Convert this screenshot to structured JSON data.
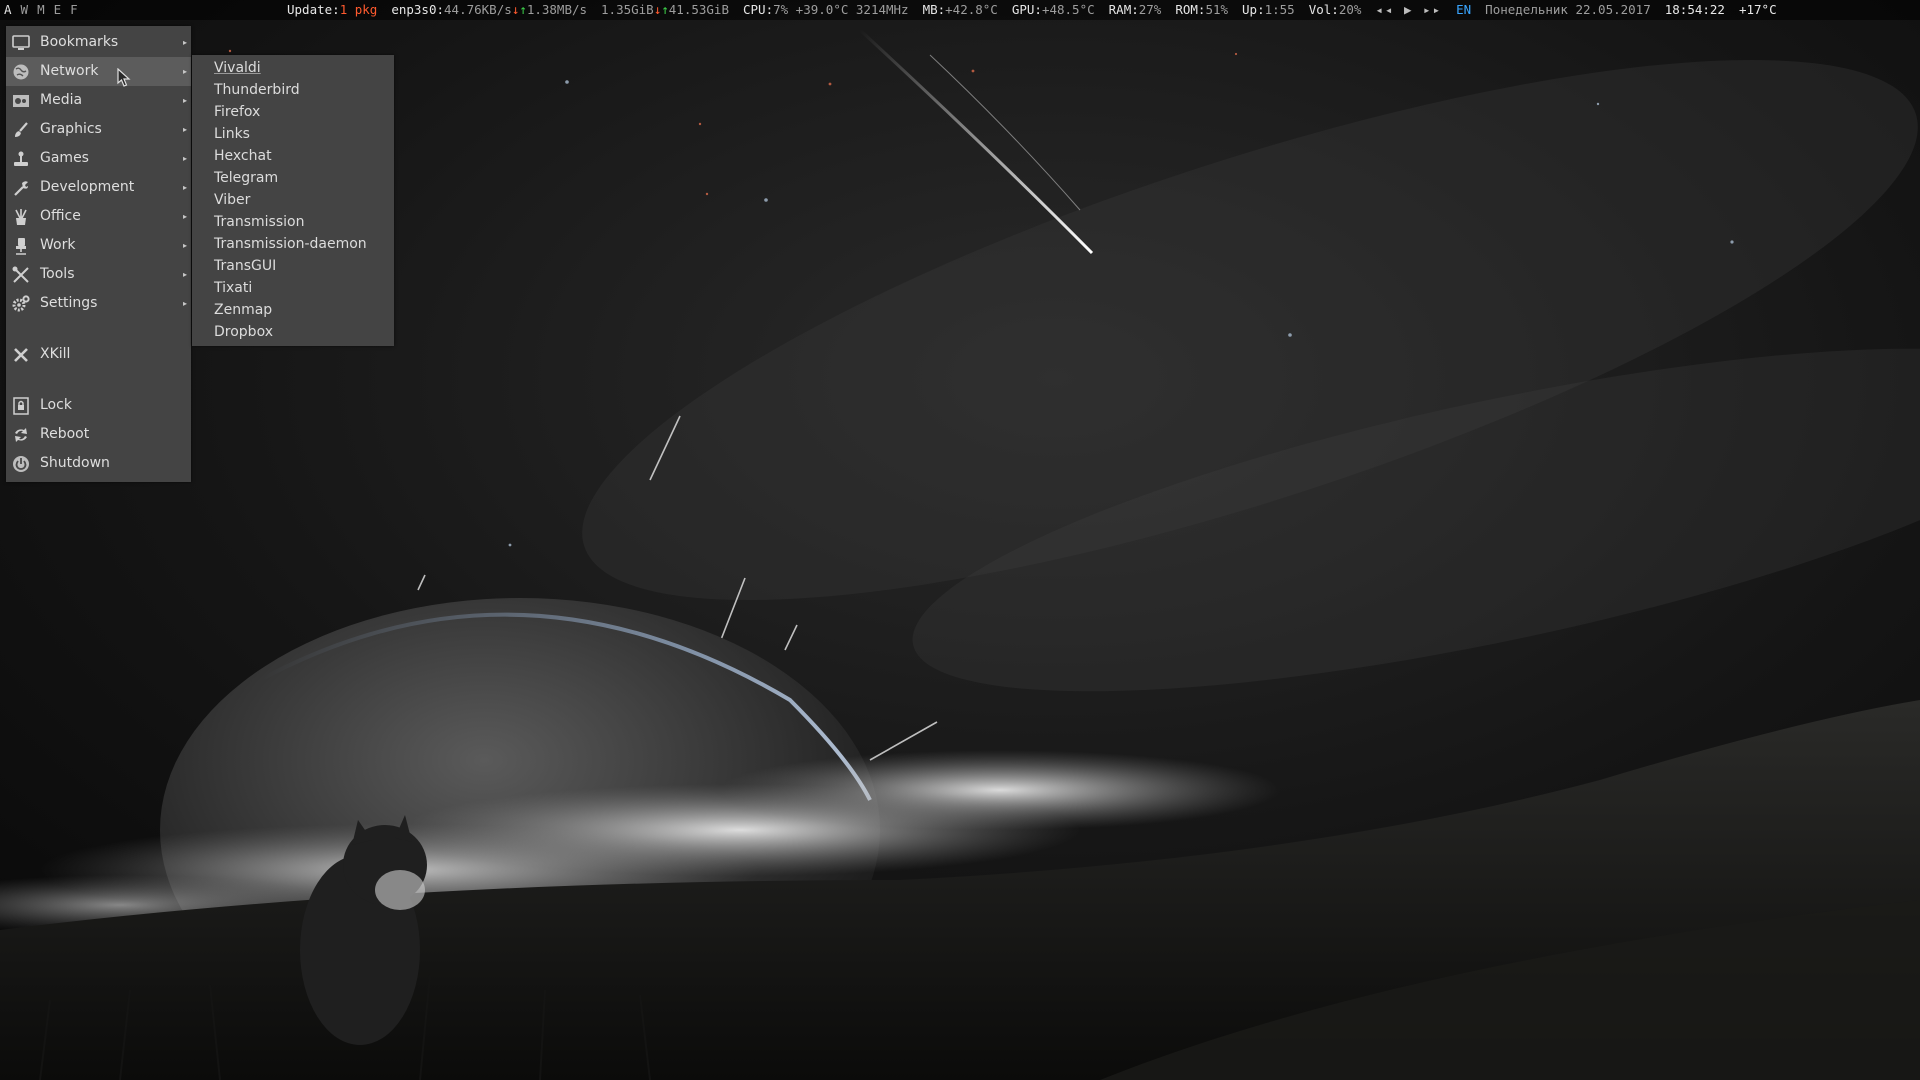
{
  "workspaces": [
    "A",
    "W",
    "M",
    "E",
    "F"
  ],
  "topbar": {
    "update_label": "Update:",
    "update_value": "1 pkg",
    "net_iface": "enp3s0:",
    "net_down_rate": "44.76KB/s",
    "net_up_rate": "1.38MB/s",
    "net_down_total": "1.35GiB",
    "net_up_total": "41.53GiB",
    "cpu_label": "CPU:",
    "cpu_value": "7% +39.0°C 3214MHz",
    "mb_label": "MB:",
    "mb_value": "+42.8°C",
    "gpu_label": "GPU:",
    "gpu_value": "+48.5°C",
    "ram_label": "RAM:",
    "ram_value": "27%",
    "rom_label": "ROM:",
    "rom_value": "51%",
    "up_label": "Up:",
    "up_value": "1:55",
    "vol_label": "Vol:",
    "vol_value": "20%",
    "media_prev": "◂◂",
    "media_play": "▶",
    "media_next": "▸▸",
    "lang": "EN",
    "date": "Понедельник 22.05.2017",
    "time": "18:54:22",
    "temperature": "+17°C"
  },
  "menu": {
    "items": [
      {
        "label": "Bookmarks",
        "icon": "monitor-icon"
      },
      {
        "label": "Network",
        "icon": "globe-icon"
      },
      {
        "label": "Media",
        "icon": "film-icon"
      },
      {
        "label": "Graphics",
        "icon": "brush-icon"
      },
      {
        "label": "Games",
        "icon": "joystick-icon"
      },
      {
        "label": "Development",
        "icon": "wrench-icon"
      },
      {
        "label": "Office",
        "icon": "pencil-cup-icon"
      },
      {
        "label": "Work",
        "icon": "chair-icon"
      },
      {
        "label": "Tools",
        "icon": "tools-icon"
      },
      {
        "label": "Settings",
        "icon": "gears-icon"
      }
    ],
    "xkill": {
      "label": "XKill",
      "icon": "close-icon"
    },
    "lock": {
      "label": "Lock",
      "icon": "lock-screen-icon"
    },
    "reboot": {
      "label": "Reboot",
      "icon": "reboot-icon"
    },
    "shutdown": {
      "label": "Shutdown",
      "icon": "power-icon"
    }
  },
  "submenu": {
    "items": [
      "Vivaldi",
      "Thunderbird",
      "Firefox",
      "Links",
      "Hexchat",
      "Telegram",
      "Viber",
      "Transmission",
      "Transmission-daemon",
      "TransGUI",
      "Tixati",
      "Zenmap",
      "Dropbox"
    ]
  },
  "colors": {
    "accent_warning": "#ff5a2e",
    "net_up": "#3dd14a",
    "lang": "#39a5ff",
    "menu_bg": "#484848",
    "menu_selected": "#5c5c5c"
  }
}
